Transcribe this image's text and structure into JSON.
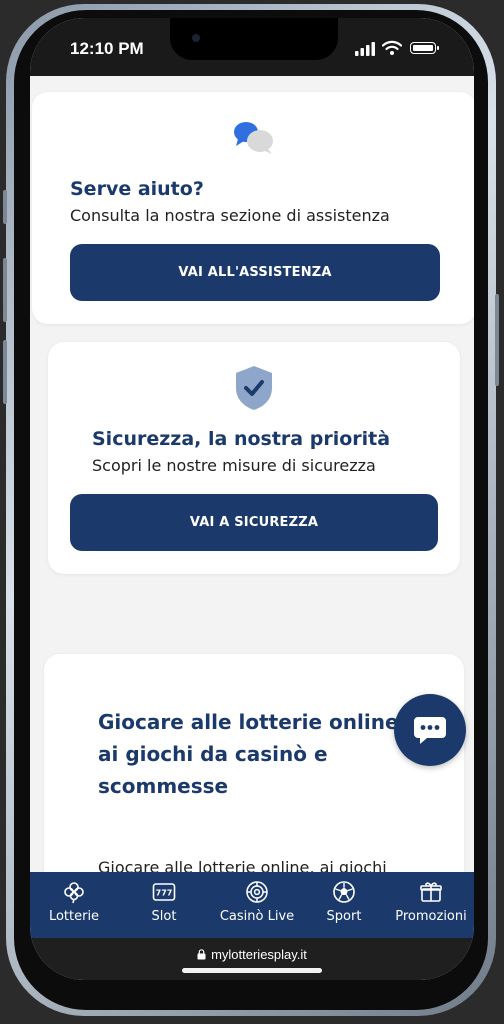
{
  "status": {
    "time": "12:10 PM"
  },
  "help_card": {
    "title": "Serve aiuto?",
    "subtitle": "Consulta la nostra sezione di assistenza",
    "button": "VAI ALL'ASSISTENZA",
    "icon": "chat-bubbles-icon"
  },
  "security_card": {
    "title": "Sicurezza, la nostra priorità",
    "subtitle": "Scopri le nostre misure di sicurezza",
    "button": "VAI A SICUREZZA",
    "icon": "shield-check-icon"
  },
  "article": {
    "title": "Giocare alle lotterie online, ai giochi da casinò e scommesse",
    "text": "Giocare alle lotterie online, ai giochi numerici, alle scommesse e ai giochi"
  },
  "nav": {
    "items": [
      {
        "label": "Lotterie",
        "icon": "clover-icon"
      },
      {
        "label": "Slot",
        "icon": "slot-777-icon"
      },
      {
        "label": "Casinò Live",
        "icon": "roulette-chip-icon"
      },
      {
        "label": "Sport",
        "icon": "soccer-ball-icon"
      },
      {
        "label": "Promozioni",
        "icon": "gift-icon"
      }
    ]
  },
  "browser": {
    "url": "mylotteriesplay.it"
  },
  "colors": {
    "brand": "#1b3a6b",
    "background": "#f3f3f3",
    "card": "#ffffff"
  }
}
